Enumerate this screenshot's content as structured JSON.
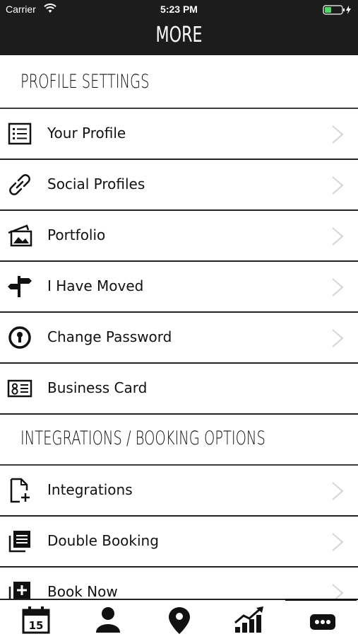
{
  "status_bar": {
    "carrier": "Carrier",
    "time": "5:23 PM"
  },
  "nav": {
    "title": "MORE"
  },
  "sections": {
    "profile": {
      "title": "PROFILE SETTINGS"
    },
    "integrations": {
      "title": "INTEGRATIONS / BOOKING OPTIONS"
    }
  },
  "rows": {
    "your_profile": "Your Profile",
    "social_profiles": "Social Profiles",
    "portfolio": "Portfolio",
    "i_have_moved": "I Have Moved",
    "change_password": "Change Password",
    "business_card": "Business Card",
    "integrations": "Integrations",
    "double_booking": "Double Booking",
    "book_now": "Book Now"
  },
  "tabbar": {
    "calendar_day": "15",
    "items": [
      "calendar-icon",
      "person-icon",
      "location-pin-icon",
      "chart-icon",
      "more-icon"
    ]
  },
  "colors": {
    "bar_bg": "#1c1c1c",
    "battery": "#4cd964"
  }
}
